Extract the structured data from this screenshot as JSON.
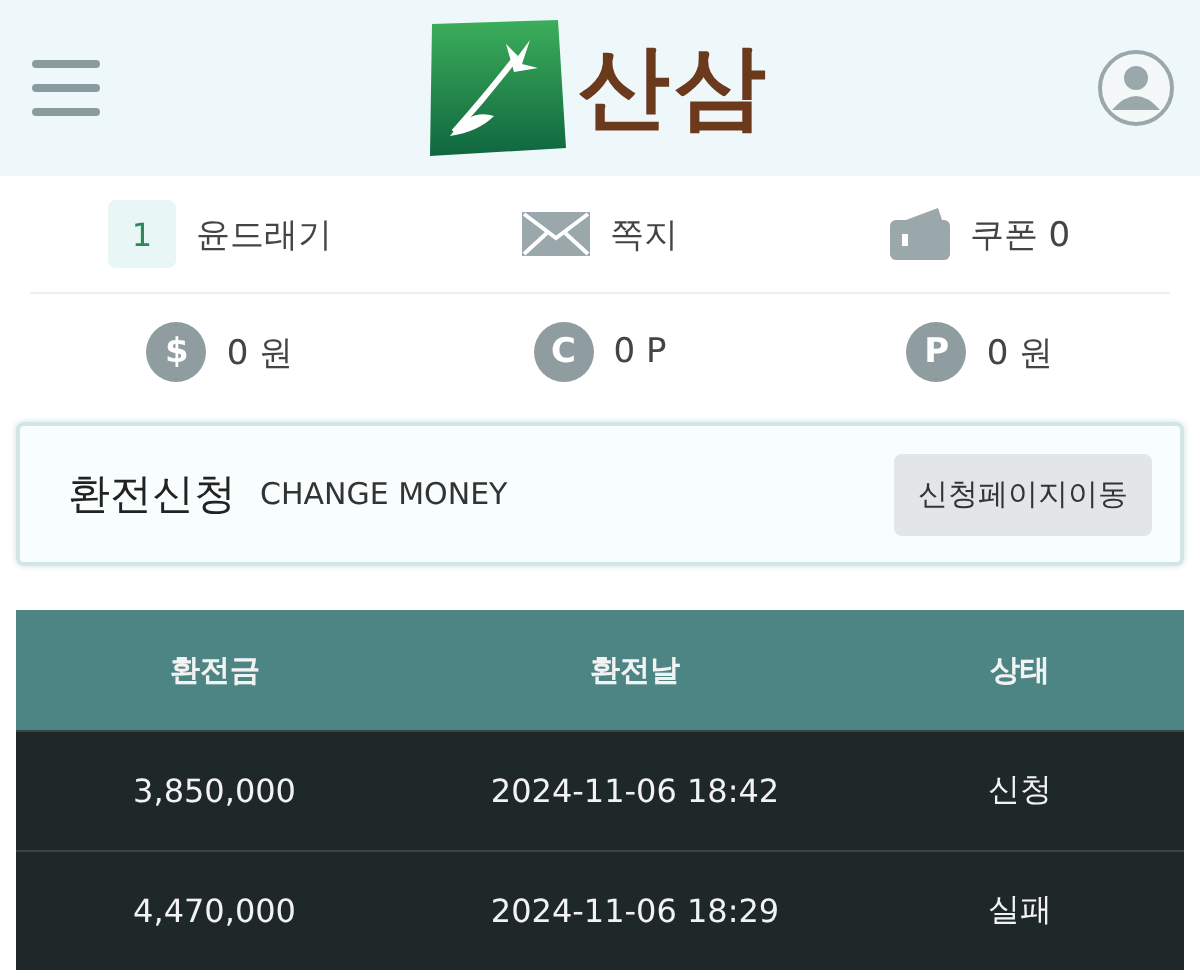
{
  "header": {
    "logo_text": "산삼"
  },
  "user_bar": [
    {
      "kind": "level",
      "badge": "1",
      "label": "윤드래기"
    },
    {
      "kind": "message",
      "label": "쪽지"
    },
    {
      "kind": "coupon",
      "label": "쿠폰 0"
    }
  ],
  "balances": [
    {
      "symbol": "$",
      "amount": "0 원"
    },
    {
      "symbol": "C",
      "amount": "0 P"
    },
    {
      "symbol": "P",
      "amount": "0 원"
    }
  ],
  "exchange": {
    "title": "환전신청",
    "subtitle": "CHANGE MONEY",
    "button": "신청페이지이동"
  },
  "table": {
    "columns": [
      "환전금",
      "환전날",
      "상태"
    ],
    "rows": [
      [
        "3,850,000",
        "2024-11-06 18:42",
        "신청"
      ],
      [
        "4,470,000",
        "2024-11-06 18:29",
        "실패"
      ]
    ]
  }
}
